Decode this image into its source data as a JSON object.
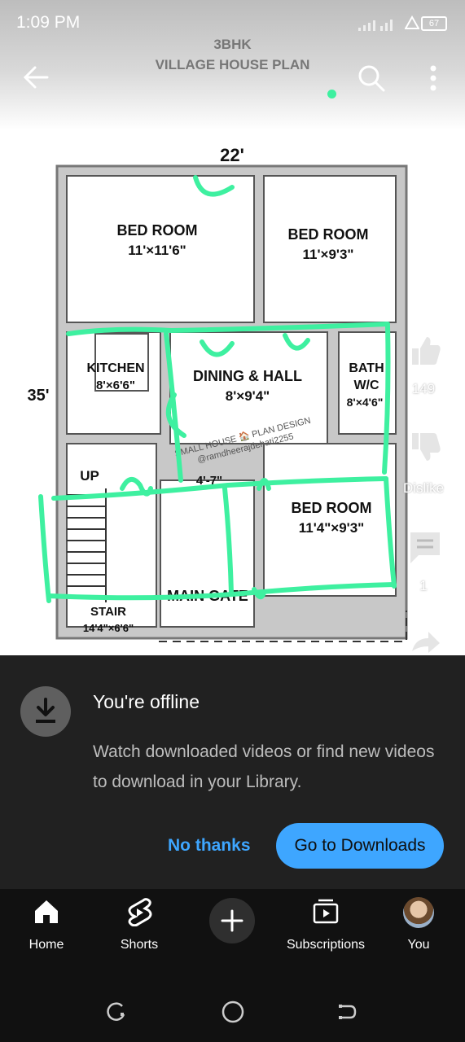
{
  "status_bar": {
    "time": "1:09 PM",
    "battery": "67"
  },
  "video": {
    "title_line1": "3BHK",
    "title_line2": "VILLAGE HOUSE PLAN",
    "plan": {
      "width_label": "22'",
      "depth_label": "35'",
      "rooms": [
        {
          "name": "BED ROOM",
          "size": "11'×11'6\""
        },
        {
          "name": "BED ROOM",
          "size": "11'×9'3\""
        },
        {
          "name": "KITCHEN",
          "size": "8'×6'6\""
        },
        {
          "name": "DINING & HALL",
          "size": "8'×9'4\""
        },
        {
          "name": "BATH",
          "name2": "W/C",
          "size": "8'×4'6\""
        },
        {
          "name": "BED ROOM",
          "size": "11'4\"×9'3\""
        },
        {
          "name": "STAIR",
          "size": "14'4\"×6'6\""
        }
      ],
      "up_label": "UP",
      "main_gate": "MAIN GATE",
      "passage": "4'-7\"",
      "watermark1": "SMALL HOUSE 🏠 PLAN DESIGN",
      "watermark2": "@ramdheerajdehati2255"
    }
  },
  "side_actions": {
    "like_count": "149",
    "dislike_label": "Dislike",
    "comment_count": "1"
  },
  "offline_sheet": {
    "title": "You're offline",
    "message": "Watch downloaded videos or find new videos to download in your Library.",
    "no_thanks": "No thanks",
    "go_downloads": "Go to Downloads"
  },
  "bottom_nav": {
    "items": [
      {
        "label": "Home",
        "icon": "home-icon"
      },
      {
        "label": "Shorts",
        "icon": "shorts-icon"
      },
      {
        "label": "",
        "icon": "create-icon"
      },
      {
        "label": "Subscriptions",
        "icon": "subscriptions-icon"
      },
      {
        "label": "You",
        "icon": "avatar"
      }
    ]
  },
  "colors": {
    "accent": "#3ea6ff",
    "marker": "#3ef0a0"
  }
}
